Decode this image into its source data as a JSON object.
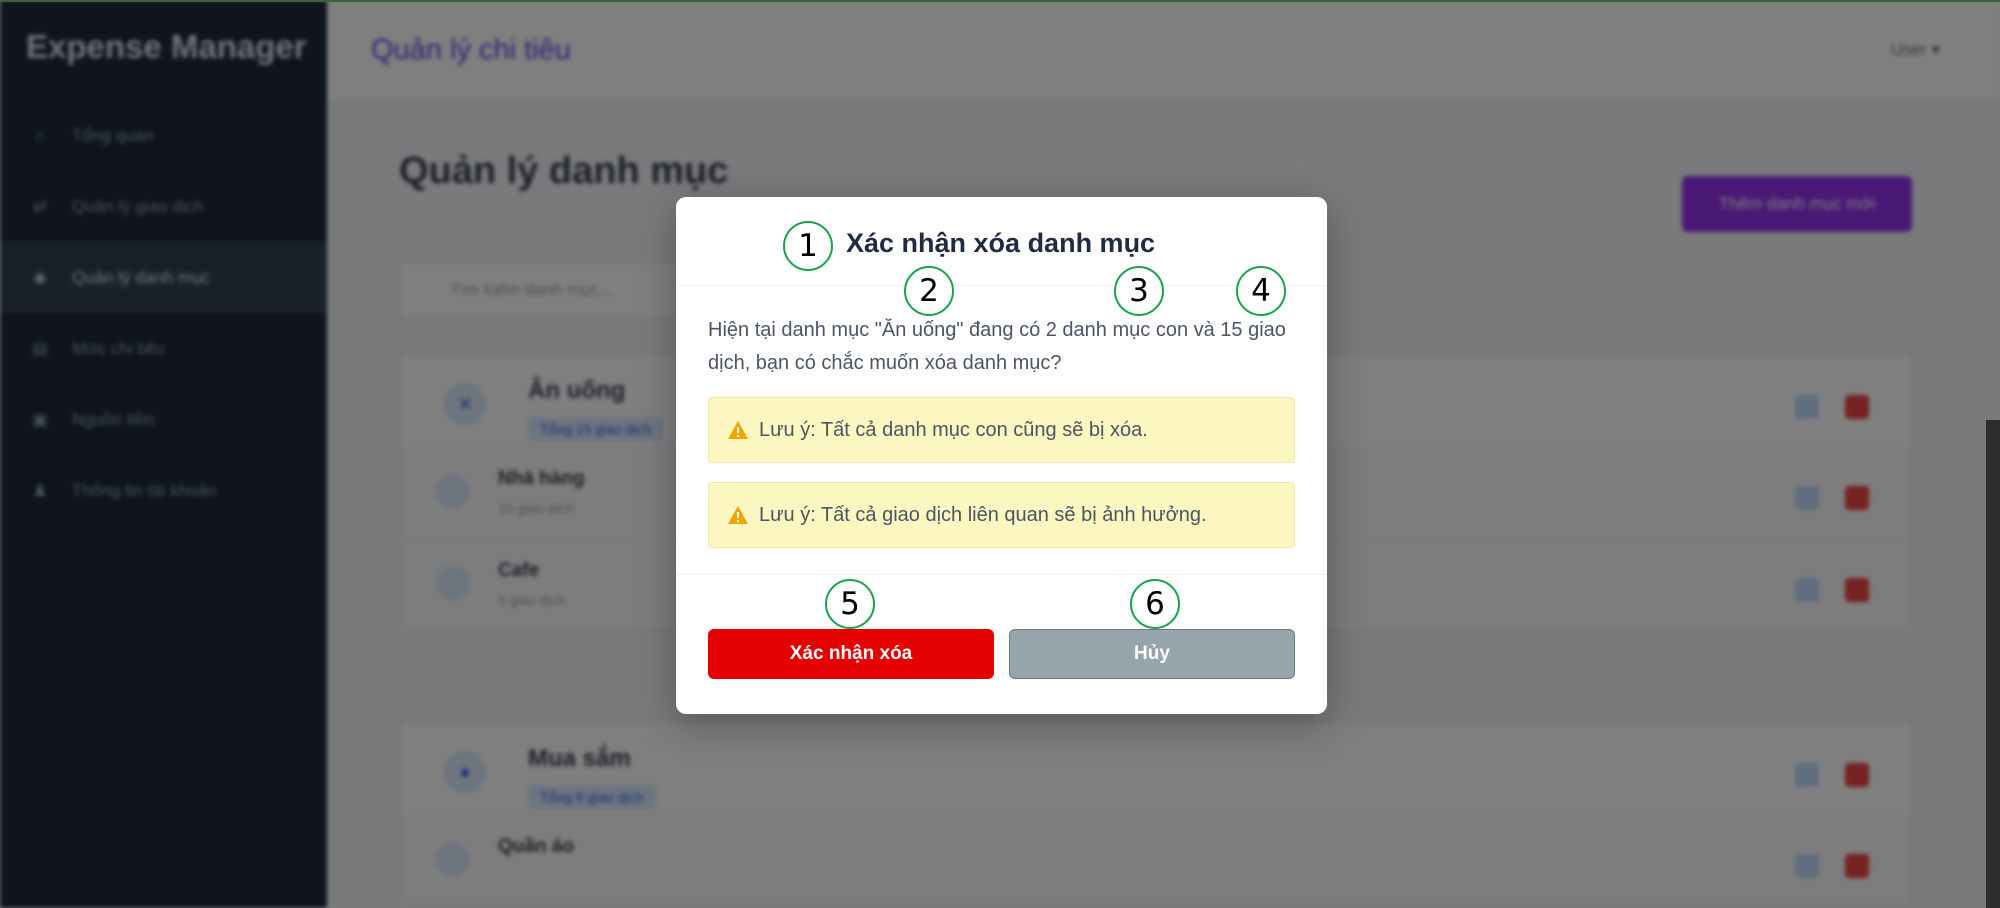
{
  "app": {
    "brand": "Expense Manager",
    "topbar_title": "Quản lý chi tiêu",
    "user_menu": "User ▾"
  },
  "sidebar": {
    "items": [
      {
        "label": "Tổng quan",
        "icon": "home-icon"
      },
      {
        "label": "Quản lý giao dịch",
        "icon": "exchange-icon"
      },
      {
        "label": "Quản lý danh mục",
        "icon": "tags-icon",
        "active": true
      },
      {
        "label": "Mức chi tiêu",
        "icon": "chart-icon"
      },
      {
        "label": "Nguồn tiền",
        "icon": "wallet-icon"
      },
      {
        "label": "Thông tin tài khoản",
        "icon": "user-icon"
      }
    ]
  },
  "main": {
    "page_title": "Quản lý danh mục",
    "add_button": "Thêm danh mục mới",
    "search_placeholder": "Tìm kiếm danh mục...",
    "categories": [
      {
        "name": "Ăn uống",
        "badge": "Tổng 15 giao dịch",
        "subs": [
          {
            "name": "Nhà hàng",
            "count": "10 giao dịch"
          },
          {
            "name": "Cafe",
            "count": "5 giao dịch"
          }
        ]
      },
      {
        "name": "Mua sắm",
        "badge": "Tổng 8 giao dịch",
        "subs": [
          {
            "name": "Quần áo",
            "count": ""
          }
        ]
      }
    ]
  },
  "modal": {
    "title": "Xác nhận xóa danh mục",
    "message": "Hiện tại danh mục \"Ăn uống\" đang có 2 danh mục con và 15 giao dịch, bạn có chắc muốn xóa danh mục?",
    "warning_1": "Lưu ý: Tất cả danh mục con cũng sẽ bị xóa.",
    "warning_2": "Lưu ý: Tất cả giao dịch liên quan sẽ bị ảnh hưởng.",
    "confirm_button": "Xác nhận xóa",
    "cancel_button": "Hủy"
  },
  "callouts": [
    "1",
    "2",
    "3",
    "4",
    "5",
    "6"
  ],
  "colors": {
    "confirm": "#e40000",
    "cancel": "#95a5ab",
    "warning_bg": "#fcf7c0",
    "warning_icon": "#f0a500",
    "callout_border": "#16a34a"
  }
}
